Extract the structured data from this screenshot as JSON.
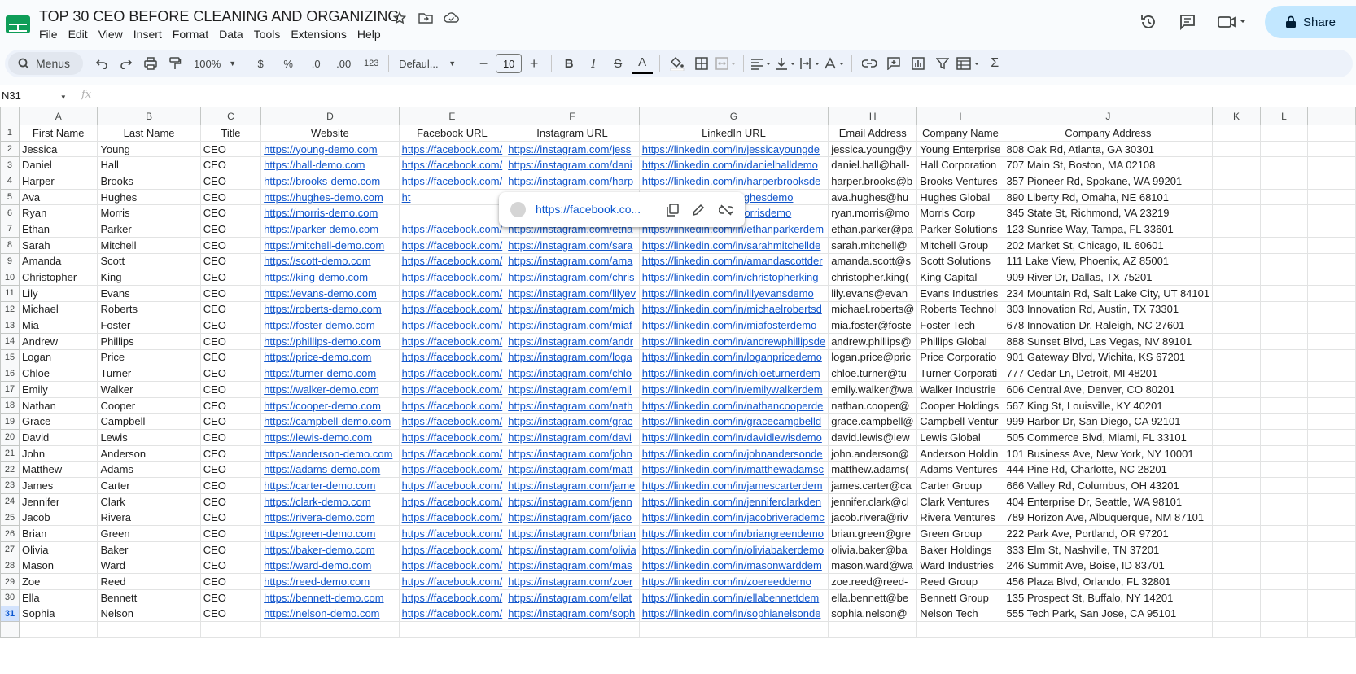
{
  "app": {
    "title": "TOP 30 CEO BEFORE CLEANING AND ORGANIZING",
    "menu": [
      "File",
      "Edit",
      "View",
      "Insert",
      "Format",
      "Data",
      "Tools",
      "Extensions",
      "Help"
    ],
    "share_label": "Share"
  },
  "toolbar": {
    "menus_label": "Menus",
    "zoom": "100%",
    "currency": "$",
    "percent": "%",
    "dec_decrease": ".0",
    "dec_increase": ".00",
    "number_format": "123",
    "font": "Defaul...",
    "font_size": "10",
    "minus": "−",
    "plus": "+",
    "bold": "B",
    "italic": "I",
    "strike": "S",
    "text_color": "A",
    "sigma": "Σ"
  },
  "formula_bar": {
    "cell_ref": "N31",
    "fx": "fx"
  },
  "columns": [
    "A",
    "B",
    "C",
    "D",
    "E",
    "F",
    "G",
    "H",
    "I",
    "J",
    "K",
    "L"
  ],
  "headers": [
    "First Name",
    "Last Name",
    "Title",
    "Website",
    "Facebook URL",
    "Instagram URL",
    "LinkedIn URL",
    "Email Address",
    "Company Name",
    "Company Address"
  ],
  "rows": [
    [
      "Jessica",
      "Young",
      "CEO",
      "https://young-demo.com",
      "https://facebook.com/",
      "https://instagram.com/jess",
      "https://linkedin.com/in/jessicayoungde",
      "jessica.young@y",
      "Young Enterprise",
      "808 Oak Rd, Atlanta, GA 30301"
    ],
    [
      "Daniel",
      "Hall",
      "CEO",
      "https://hall-demo.com",
      "https://facebook.com/",
      "https://instagram.com/dani",
      "https://linkedin.com/in/danielhalldemo",
      "daniel.hall@hall-",
      "Hall Corporation",
      "707 Main St, Boston, MA 02108"
    ],
    [
      "Harper",
      "Brooks",
      "CEO",
      "https://brooks-demo.com",
      "https://facebook.com/",
      "https://instagram.com/harp",
      "https://linkedin.com/in/harperbrooksde",
      "harper.brooks@b",
      "Brooks Ventures",
      "357 Pioneer Rd, Spokane, WA 99201"
    ],
    [
      "Ava",
      "Hughes",
      "CEO",
      "https://hughes-demo.com",
      "ht",
      "",
      "linkedin.com/in/avahughesdemo",
      "ava.hughes@hu",
      "Hughes Global",
      "890 Liberty Rd, Omaha, NE 68101"
    ],
    [
      "Ryan",
      "Morris",
      "CEO",
      "https://morris-demo.com",
      "",
      "",
      "linkedin.com/in/ryanmorrisdemo",
      "ryan.morris@mo",
      "Morris Corp",
      "345 State St, Richmond, VA 23219"
    ],
    [
      "Ethan",
      "Parker",
      "CEO",
      "https://parker-demo.com",
      "https://facebook.com/",
      "https://instagram.com/etha",
      "https://linkedin.com/in/ethanparkerdem",
      "ethan.parker@pa",
      "Parker Solutions",
      "123 Sunrise Way, Tampa, FL 33601"
    ],
    [
      "Sarah",
      "Mitchell",
      "CEO",
      "https://mitchell-demo.com",
      "https://facebook.com/",
      "https://instagram.com/sara",
      "https://linkedin.com/in/sarahmitchellde",
      "sarah.mitchell@",
      "Mitchell Group",
      "202 Market St, Chicago, IL 60601"
    ],
    [
      "Amanda",
      "Scott",
      "CEO",
      "https://scott-demo.com",
      "https://facebook.com/",
      "https://instagram.com/ama",
      "https://linkedin.com/in/amandascottder",
      "amanda.scott@s",
      "Scott Solutions",
      "111 Lake View, Phoenix, AZ 85001"
    ],
    [
      "Christopher",
      "King",
      "CEO",
      "https://king-demo.com",
      "https://facebook.com/",
      "https://instagram.com/chris",
      "https://linkedin.com/in/christopherking",
      "christopher.king(",
      "King Capital",
      "909 River Dr, Dallas, TX 75201"
    ],
    [
      "Lily",
      "Evans",
      "CEO",
      "https://evans-demo.com",
      "https://facebook.com/",
      "https://instagram.com/lilyev",
      "https://linkedin.com/in/lilyevansdemo",
      "lily.evans@evan",
      "Evans Industries",
      "234 Mountain Rd, Salt Lake City, UT 84101"
    ],
    [
      "Michael",
      "Roberts",
      "CEO",
      "https://roberts-demo.com",
      "https://facebook.com/",
      "https://instagram.com/mich",
      "https://linkedin.com/in/michaelrobertsd",
      "michael.roberts@",
      "Roberts Technol",
      "303 Innovation Rd, Austin, TX 73301"
    ],
    [
      "Mia",
      "Foster",
      "CEO",
      "https://foster-demo.com",
      "https://facebook.com/",
      "https://instagram.com/miaf",
      "https://linkedin.com/in/miafosterdemo",
      "mia.foster@foste",
      "Foster Tech",
      "678 Innovation Dr, Raleigh, NC 27601"
    ],
    [
      "Andrew",
      "Phillips",
      "CEO",
      "https://phillips-demo.com",
      "https://facebook.com/",
      "https://instagram.com/andr",
      "https://linkedin.com/in/andrewphillipsde",
      "andrew.phillips@",
      "Phillips Global",
      "888 Sunset Blvd, Las Vegas, NV 89101"
    ],
    [
      "Logan",
      "Price",
      "CEO",
      "https://price-demo.com",
      "https://facebook.com/",
      "https://instagram.com/loga",
      "https://linkedin.com/in/loganpricedemo",
      "logan.price@pric",
      "Price Corporatio",
      "901 Gateway Blvd, Wichita, KS 67201"
    ],
    [
      "Chloe",
      "Turner",
      "CEO",
      "https://turner-demo.com",
      "https://facebook.com/",
      "https://instagram.com/chlo",
      "https://linkedin.com/in/chloeturnerdem",
      "chloe.turner@tu",
      "Turner Corporati",
      "777 Cedar Ln, Detroit, MI 48201"
    ],
    [
      "Emily",
      "Walker",
      "CEO",
      "https://walker-demo.com",
      "https://facebook.com/",
      "https://instagram.com/emil",
      "https://linkedin.com/in/emilywalkerdem",
      "emily.walker@wa",
      "Walker Industrie",
      "606 Central Ave, Denver, CO 80201"
    ],
    [
      "Nathan",
      "Cooper",
      "CEO",
      "https://cooper-demo.com",
      "https://facebook.com/",
      "https://instagram.com/nath",
      "https://linkedin.com/in/nathancooperde",
      "nathan.cooper@",
      "Cooper Holdings",
      "567 King St, Louisville, KY 40201"
    ],
    [
      "Grace",
      "Campbell",
      "CEO",
      "https://campbell-demo.com",
      "https://facebook.com/",
      "https://instagram.com/grac",
      "https://linkedin.com/in/gracecampbelld",
      "grace.campbell@",
      "Campbell Ventur",
      "999 Harbor Dr, San Diego, CA 92101"
    ],
    [
      "David",
      "Lewis",
      "CEO",
      "https://lewis-demo.com",
      "https://facebook.com/",
      "https://instagram.com/davi",
      "https://linkedin.com/in/davidlewisdemo",
      "david.lewis@lew",
      "Lewis Global",
      "505 Commerce Blvd, Miami, FL 33101"
    ],
    [
      "John",
      "Anderson",
      "CEO",
      "https://anderson-demo.com",
      "https://facebook.com/",
      "https://instagram.com/john",
      "https://linkedin.com/in/johnandersonde",
      "john.anderson@",
      "Anderson Holdin",
      "101 Business Ave, New York, NY 10001"
    ],
    [
      "Matthew",
      "Adams",
      "CEO",
      "https://adams-demo.com",
      "https://facebook.com/",
      "https://instagram.com/matt",
      "https://linkedin.com/in/matthewadamsc",
      "matthew.adams(",
      "Adams Ventures",
      "444 Pine Rd, Charlotte, NC 28201"
    ],
    [
      "James",
      "Carter",
      "CEO",
      "https://carter-demo.com",
      "https://facebook.com/",
      "https://instagram.com/jame",
      "https://linkedin.com/in/jamescarterdem",
      "james.carter@ca",
      "Carter Group",
      "666 Valley Rd, Columbus, OH 43201"
    ],
    [
      "Jennifer",
      "Clark",
      "CEO",
      "https://clark-demo.com",
      "https://facebook.com/",
      "https://instagram.com/jenn",
      "https://linkedin.com/in/jenniferclarkden",
      "jennifer.clark@cl",
      "Clark Ventures",
      "404 Enterprise Dr, Seattle, WA 98101"
    ],
    [
      "Jacob",
      "Rivera",
      "CEO",
      "https://rivera-demo.com",
      "https://facebook.com/",
      "https://instagram.com/jaco",
      "https://linkedin.com/in/jacobriverademc",
      "jacob.rivera@riv",
      "Rivera Ventures",
      "789 Horizon Ave, Albuquerque, NM 87101"
    ],
    [
      "Brian",
      "Green",
      "CEO",
      "https://green-demo.com",
      "https://facebook.com/",
      "https://instagram.com/brian",
      "https://linkedin.com/in/briangreendemo",
      "brian.green@gre",
      "Green Group",
      "222 Park Ave, Portland, OR 97201"
    ],
    [
      "Olivia",
      "Baker",
      "CEO",
      "https://baker-demo.com",
      "https://facebook.com/",
      "https://instagram.com/olivia",
      "https://linkedin.com/in/oliviabakerdemo",
      "olivia.baker@ba",
      "Baker Holdings",
      "333 Elm St, Nashville, TN 37201"
    ],
    [
      "Mason",
      "Ward",
      "CEO",
      "https://ward-demo.com",
      "https://facebook.com/",
      "https://instagram.com/mas",
      "https://linkedin.com/in/masonwarddem",
      "mason.ward@wa",
      "Ward Industries",
      "246 Summit Ave, Boise, ID 83701"
    ],
    [
      "Zoe",
      "Reed",
      "CEO",
      "https://reed-demo.com",
      "https://facebook.com/",
      "https://instagram.com/zoer",
      "https://linkedin.com/in/zoereeddemo",
      "zoe.reed@reed-",
      "Reed Group",
      "456 Plaza Blvd, Orlando, FL 32801"
    ],
    [
      "Ella",
      "Bennett",
      "CEO",
      "https://bennett-demo.com",
      "https://facebook.com/",
      "https://instagram.com/ellat",
      "https://linkedin.com/in/ellabennettdem",
      "ella.bennett@be",
      "Bennett Group",
      "135 Prospect St, Buffalo, NY 14201"
    ],
    [
      "Sophia",
      "Nelson",
      "CEO",
      "https://nelson-demo.com",
      "https://facebook.com/",
      "https://instagram.com/soph",
      "https://linkedin.com/in/sophianelsonde",
      "sophia.nelson@",
      "Nelson Tech",
      "555 Tech Park, San Jose, CA 95101"
    ]
  ],
  "link_popup": {
    "url": "https://facebook.co..."
  },
  "colors": {
    "link": "#1155cc",
    "share_bg": "#c2e7ff",
    "toolbar_bg": "#edf2fa",
    "selected_row": "#d3e3fd"
  }
}
